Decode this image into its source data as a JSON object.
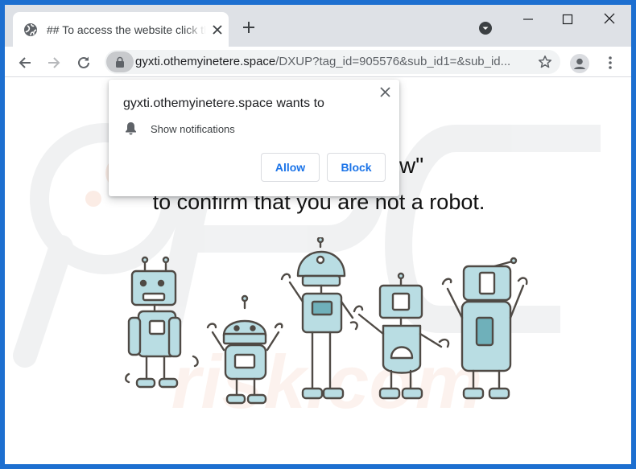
{
  "tab": {
    "title": "## To access the website click the"
  },
  "address_bar": {
    "host": "gyxti.othemyinetere.space",
    "path": "/DXUP?tag_id=905576&sub_id1=&sub_id..."
  },
  "page": {
    "heading_fragment": "w\"",
    "subline": "to confirm that you are not a robot."
  },
  "notification_popup": {
    "title": "gyxti.othemyinetere.space wants to",
    "permission": "Show notifications",
    "allow_label": "Allow",
    "block_label": "Block"
  },
  "watermark": {
    "text": "risk.com"
  },
  "colors": {
    "frame": "#1d6fd0",
    "tab_strip": "#dee1e6",
    "button_text": "#1a73e8",
    "robot_fill": "#b9dde3",
    "robot_stroke": "#4f4a45"
  }
}
